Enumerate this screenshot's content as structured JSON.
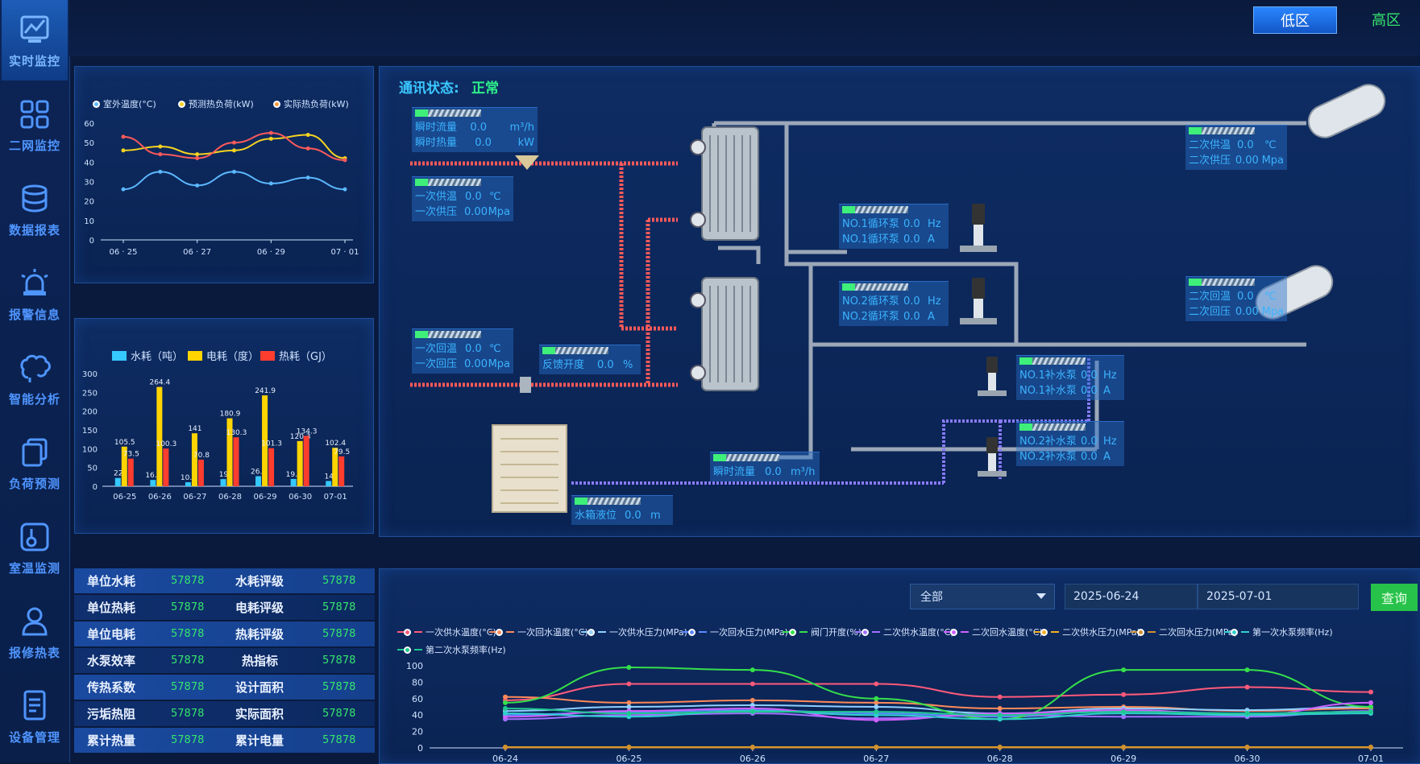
{
  "sidebar": {
    "items": [
      {
        "label": "实时监控",
        "icon": "monitor-icon",
        "active": true
      },
      {
        "label": "二网监控",
        "icon": "grid-icon"
      },
      {
        "label": "数据报表",
        "icon": "database-icon"
      },
      {
        "label": "报警信息",
        "icon": "alarm-icon"
      },
      {
        "label": "智能分析",
        "icon": "brain-icon"
      },
      {
        "label": "负荷预测",
        "icon": "layers-icon"
      },
      {
        "label": "室温监测",
        "icon": "thermometer-icon"
      },
      {
        "label": "报修热表",
        "icon": "user-icon"
      },
      {
        "label": "设备管理",
        "icon": "document-icon"
      }
    ]
  },
  "topbar": {
    "low_zone": "低区",
    "high_zone": "高区"
  },
  "chart_data": [
    {
      "type": "line",
      "categories": [
        "06-25",
        "06-26",
        "06-27",
        "06-28",
        "06-29",
        "06-30",
        "07-01"
      ],
      "ylim": [
        0,
        60
      ],
      "yticks": [
        "60",
        "50",
        "40",
        "30",
        "20",
        "10",
        "0"
      ],
      "xticks": [
        "06 · 25",
        "06 · 27",
        "06 · 29",
        "07 · 01"
      ],
      "series": [
        {
          "name": "室外温度(°C)",
          "values": [
            26,
            35,
            28,
            35,
            29,
            32,
            26
          ],
          "color": "#5cb8ff"
        },
        {
          "name": "预测热负荷(kW)",
          "values": [
            46,
            48,
            44,
            46,
            52,
            54,
            42
          ],
          "color": "#f5d320"
        },
        {
          "name": "实际热负荷(kW)",
          "values": [
            53,
            44,
            42,
            50,
            55,
            47,
            41
          ],
          "color": "#ff5a5a"
        }
      ]
    },
    {
      "type": "bar",
      "categories": [
        "06-25",
        "06-26",
        "06-27",
        "06-28",
        "06-29",
        "06-30",
        "07-01"
      ],
      "ylim": [
        0,
        300
      ],
      "yticks": [
        "300",
        "250",
        "200",
        "150",
        "100",
        "50",
        "0"
      ],
      "series": [
        {
          "name": "水耗（吨）",
          "values": [
            22,
            16.8,
            10.8,
            19,
            26.8,
            19.5,
            14
          ],
          "color": "#35c9ff"
        },
        {
          "name": "电耗（度）",
          "values": [
            105.5,
            264.4,
            141,
            180.9,
            241.9,
            120.3,
            102.4
          ],
          "color": "#ffd400"
        },
        {
          "name": "热耗（GJ）",
          "values": [
            73.5,
            100.3,
            70.8,
            130.3,
            101.3,
            134.3,
            79.5
          ],
          "color": "#ff3d2e"
        }
      ]
    },
    {
      "type": "line",
      "categories": [
        "06-24",
        "06-25",
        "06-26",
        "06-27",
        "06-28",
        "06-29",
        "06-30",
        "07-01"
      ],
      "ylim": [
        0,
        100
      ],
      "yticks": [
        "100",
        "80",
        "60",
        "40",
        "20",
        "0"
      ],
      "series": [
        {
          "name": "一次供水温度(°C)",
          "values": [
            58,
            78,
            78,
            78,
            62,
            65,
            74,
            68
          ],
          "color": "#ff5a7a"
        },
        {
          "name": "一次回水温度(°C)",
          "values": [
            62,
            55,
            58,
            55,
            48,
            50,
            45,
            48
          ],
          "color": "#ff8a5a"
        },
        {
          "name": "一次供水压力(MPa)",
          "values": [
            45,
            50,
            52,
            50,
            42,
            48,
            46,
            50
          ],
          "color": "#8fd0ff"
        },
        {
          "name": "一次回水压力(MPa)",
          "values": [
            40,
            44,
            46,
            42,
            38,
            45,
            42,
            44
          ],
          "color": "#5a8aff"
        },
        {
          "name": "阀门开度(%)",
          "values": [
            55,
            98,
            95,
            60,
            35,
            95,
            95,
            50
          ],
          "color": "#35e04a"
        },
        {
          "name": "二次供水温度(°C)",
          "values": [
            35,
            40,
            42,
            36,
            40,
            38,
            38,
            45
          ],
          "color": "#a070ff"
        },
        {
          "name": "二次回水温度(°C)",
          "values": [
            38,
            45,
            48,
            34,
            42,
            46,
            40,
            55
          ],
          "color": "#d060ff"
        },
        {
          "name": "二次供水压力(MPa)",
          "values": [
            1,
            1,
            1,
            1,
            1,
            1,
            1,
            1
          ],
          "color": "#f5b020"
        },
        {
          "name": "二次回水压力(MPa)",
          "values": [
            0.5,
            0.5,
            0.5,
            0.5,
            0.5,
            0.5,
            0.5,
            0.5
          ],
          "color": "#d09030"
        },
        {
          "name": "第一次水泵频率(Hz)",
          "values": [
            42,
            38,
            45,
            40,
            35,
            42,
            40,
            42
          ],
          "color": "#30d0d0"
        },
        {
          "name": "第二次水泵频率(Hz)",
          "values": [
            48,
            42,
            44,
            44,
            40,
            44,
            42,
            44
          ],
          "color": "#20c890"
        }
      ]
    }
  ],
  "process": {
    "comm_label": "通讯状态:",
    "comm_value": "正常",
    "readouts": [
      {
        "rows": [
          [
            "瞬时流量",
            "0.0",
            "m³/h"
          ],
          [
            "瞬时热量",
            "0.0",
            "kW"
          ]
        ]
      },
      {
        "rows": [
          [
            "一次供温",
            "0.0",
            "℃"
          ],
          [
            "一次供压",
            "0.00",
            "Mpa"
          ]
        ]
      },
      {
        "rows": [
          [
            "一次回温",
            "0.0",
            "℃"
          ],
          [
            "一次回压",
            "0.00",
            "Mpa"
          ]
        ]
      },
      {
        "rows": [
          [
            "反馈开度",
            "0.0",
            "%"
          ]
        ]
      },
      {
        "rows": [
          [
            "二次供温",
            "0.0",
            "℃"
          ],
          [
            "二次供压",
            "0.00",
            "Mpa"
          ]
        ]
      },
      {
        "rows": [
          [
            "NO.1循环泵",
            "0.0",
            "Hz"
          ],
          [
            "NO.1循环泵",
            "0.0",
            "A"
          ]
        ]
      },
      {
        "rows": [
          [
            "NO.2循环泵",
            "0.0",
            "Hz"
          ],
          [
            "NO.2循环泵",
            "0.0",
            "A"
          ]
        ]
      },
      {
        "rows": [
          [
            "二次回温",
            "0.0",
            "℃"
          ],
          [
            "二次回压",
            "0.00",
            "Mpa"
          ]
        ]
      },
      {
        "rows": [
          [
            "NO.1补水泵",
            "0.0",
            "Hz"
          ],
          [
            "NO.1补水泵",
            "0.0",
            "A"
          ]
        ]
      },
      {
        "rows": [
          [
            "NO.2补水泵",
            "0.0",
            "Hz"
          ],
          [
            "NO.2补水泵",
            "0.0",
            "A"
          ]
        ]
      },
      {
        "rows": [
          [
            "瞬时流量",
            "0.0",
            "m³/h"
          ]
        ]
      },
      {
        "rows": [
          [
            "水箱液位",
            "0.0",
            "m"
          ]
        ]
      }
    ]
  },
  "stats_table": {
    "rows": [
      [
        "单位水耗",
        "57878",
        "水耗评级",
        "57878"
      ],
      [
        "单位热耗",
        "57878",
        "电耗评级",
        "57878"
      ],
      [
        "单位电耗",
        "57878",
        "热耗评级",
        "57878"
      ],
      [
        "水泵效率",
        "57878",
        "热指标",
        "57878"
      ],
      [
        "传热系数",
        "57878",
        "设计面积",
        "57878"
      ],
      [
        "污垢热阻",
        "57878",
        "实际面积",
        "57878"
      ],
      [
        "累计热量",
        "57878",
        "累计电量",
        "57878"
      ]
    ]
  },
  "query": {
    "select_value": "全部",
    "start_date": "2025-06-24",
    "end_date": "2025-07-01",
    "button": "查询"
  }
}
